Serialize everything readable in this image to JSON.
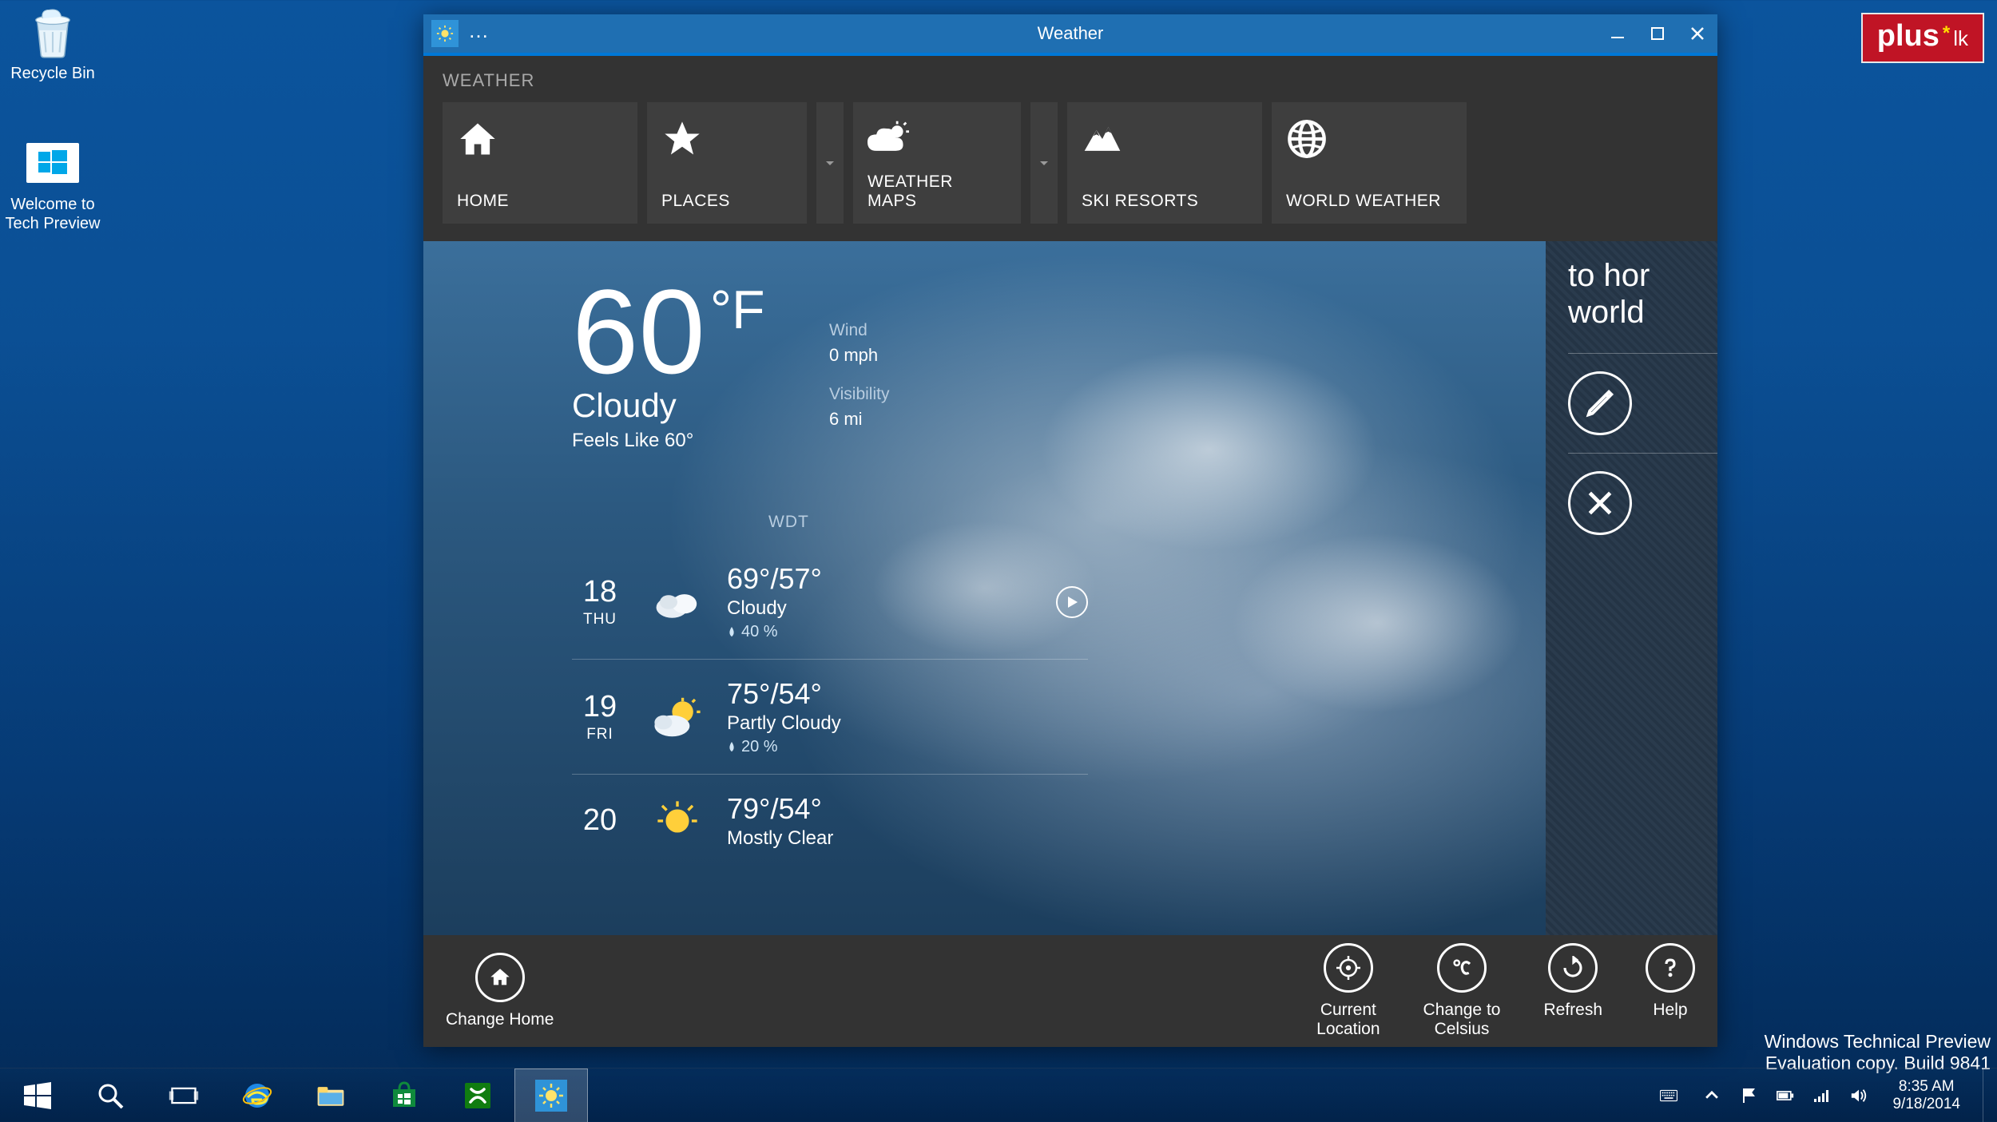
{
  "desktop": {
    "recycle_bin": "Recycle Bin",
    "tech_preview": "Welcome to\nTech Preview"
  },
  "watermark": {
    "line1": "Windows Technical Preview",
    "line2": "Evaluation copy. Build 9841"
  },
  "pluslk": {
    "brand": "plus",
    "suffix": "lk"
  },
  "window": {
    "title": "Weather",
    "ribbon_heading": "WEATHER",
    "nav": {
      "home": "HOME",
      "places": "PLACES",
      "maps": "WEATHER MAPS",
      "ski": "SKI RESORTS",
      "world": "WORLD WEATHER"
    }
  },
  "current": {
    "temp": "60",
    "unit": "°F",
    "condition": "Cloudy",
    "feels": "Feels Like 60°",
    "wind_label": "Wind",
    "wind_value": "0 mph",
    "vis_label": "Visibility",
    "vis_value": "6 mi",
    "provider": "WDT"
  },
  "forecast": [
    {
      "date": "18",
      "day": "THU",
      "hi_lo": "69°/57°",
      "cond": "Cloudy",
      "precip": "40 %"
    },
    {
      "date": "19",
      "day": "FRI",
      "hi_lo": "75°/54°",
      "cond": "Partly Cloudy",
      "precip": "20 %"
    },
    {
      "date": "20",
      "day": "",
      "hi_lo": "79°/54°",
      "cond": "Mostly Clear",
      "precip": ""
    }
  ],
  "side_panel": {
    "heading": "to hor\nworld",
    "edit_hint": "",
    "clear_hint": ""
  },
  "app_bar": {
    "change_home": "Change Home",
    "current_location": "Current\nLocation",
    "change_celsius": "Change to\nCelsius",
    "refresh": "Refresh",
    "help": "Help"
  },
  "taskbar": {
    "time": "8:35 AM",
    "date": "9/18/2014"
  }
}
